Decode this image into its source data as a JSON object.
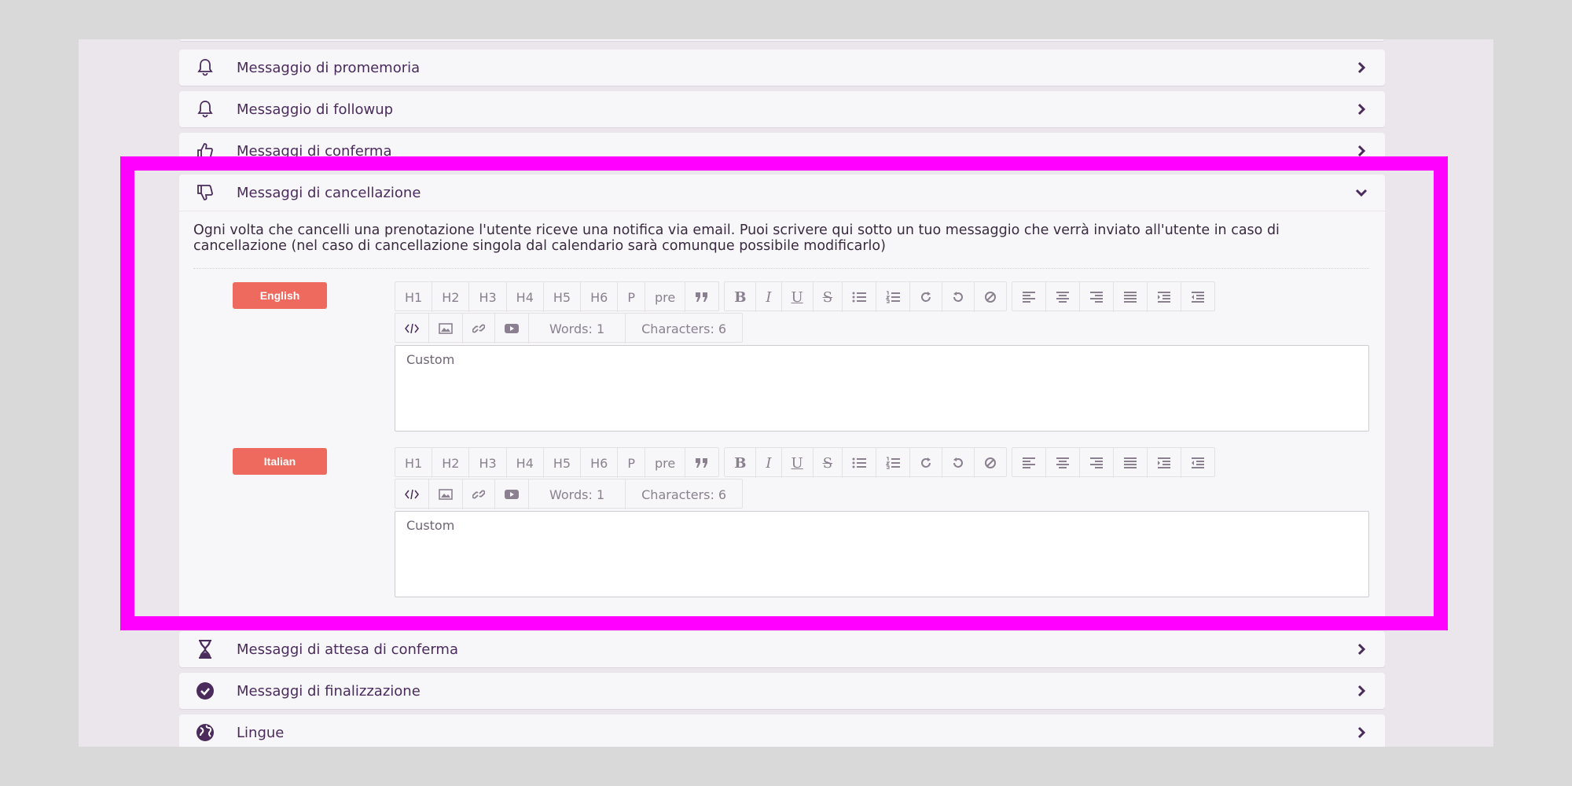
{
  "sections": [
    {
      "title": "Messaggio di promemoria",
      "icon": "bell-icon"
    },
    {
      "title": "Messaggio di followup",
      "icon": "bell-icon"
    },
    {
      "title": "Messaggi di conferma",
      "icon": "thumbs-up-icon"
    }
  ],
  "open_section": {
    "title": "Messaggi di cancellazione",
    "icon": "thumbs-down-icon",
    "description": "Ogni volta che cancelli una prenotazione l'utente riceve una notifica via email. Puoi scrivere qui sotto un tuo messaggio che verrà inviato all'utente in caso di cancellazione (nel caso di cancellazione singola dal calendario sarà comunque possibile modificarlo)",
    "editors": [
      {
        "language": "English",
        "content": "Custom",
        "words": "Words: 1",
        "characters": "Characters: 6"
      },
      {
        "language": "Italian",
        "content": "Custom",
        "words": "Words: 1",
        "characters": "Characters: 6"
      }
    ]
  },
  "toolbar": {
    "headings": [
      "H1",
      "H2",
      "H3",
      "H4",
      "H5",
      "H6",
      "P",
      "pre"
    ]
  },
  "lower_sections": [
    {
      "title": "Messaggi di attesa di conferma",
      "icon": "hourglass-icon"
    },
    {
      "title": "Messaggi di finalizzazione",
      "icon": "check-circle-icon"
    },
    {
      "title": "Lingue",
      "icon": "globe-icon"
    }
  ],
  "colors": {
    "accent": "#ef6a5e",
    "text": "#4a2b5c",
    "highlight": "#ff00ff"
  }
}
